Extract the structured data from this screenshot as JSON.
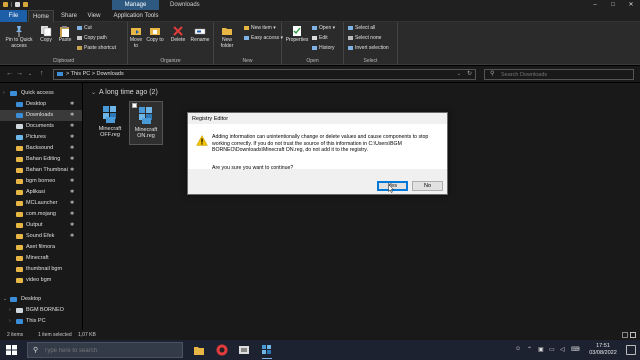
{
  "window": {
    "title": "Downloads",
    "context_tab": "Manage",
    "controls": [
      "–",
      "□",
      "✕"
    ]
  },
  "tabs": [
    "File",
    "Home",
    "Share",
    "View",
    "Application Tools"
  ],
  "ribbon": {
    "clipboard": {
      "pin": "Pin to Quick access",
      "copy": "Copy",
      "paste": "Paste",
      "cut": "Cut",
      "copy_path": "Copy path",
      "paste_shortcut": "Paste shortcut",
      "label": "Clipboard"
    },
    "organize": {
      "move_to": "Move to",
      "copy_to": "Copy to",
      "delete": "Delete",
      "rename": "Rename",
      "label": "Organize"
    },
    "new": {
      "new_folder": "New folder",
      "new_item": "New item",
      "easy_access": "Easy access",
      "label": "New"
    },
    "open": {
      "properties": "Properties",
      "open": "Open",
      "edit": "Edit",
      "history": "History",
      "label": "Open"
    },
    "select": {
      "select_all": "Select all",
      "select_none": "Select none",
      "invert": "Invert selection",
      "label": "Select"
    }
  },
  "address": {
    "path_1": "This PC",
    "path_2": "Downloads",
    "separator": ">",
    "search_placeholder": "Search Downloads"
  },
  "nav": {
    "quick_access": "Quick access",
    "items": [
      "Desktop",
      "Downloads",
      "Documents",
      "Pictures",
      "Backsound",
      "Bahan Editing",
      "Bahan Thumbnai",
      "bgm borneo",
      "Aplikasi",
      "MCLauncher",
      "com.mojang",
      "Output",
      "Sound Efek",
      "Aset filmora",
      "Minecraft",
      "thumbnail bgm",
      "video bgm"
    ],
    "bottom": [
      "Desktop",
      "BGM BORNEO",
      "This PC"
    ]
  },
  "content": {
    "group_header": "A long time ago (2)",
    "files": [
      {
        "name_1": "Minecraft",
        "name_2": "OFF.reg"
      },
      {
        "name_1": "Minecraft",
        "name_2": "ON.reg"
      }
    ]
  },
  "dialog": {
    "title": "Registry Editor",
    "message": "Adding information can unintentionally change or delete values and cause components to stop working correctly. If you do not trust the source of this information in C:\\Users\\BGM BORNEO\\Downloads\\Minecraft ON.reg, do not add it to the registry.",
    "question": "Are you sure you want to continue?",
    "yes": "Yes",
    "no": "No"
  },
  "status": {
    "count": "2 items",
    "selected": "1 item selected",
    "size": "1,07 KB"
  },
  "taskbar": {
    "search_placeholder": "Type here to search",
    "time": "17:51",
    "date": "03/08/2022"
  },
  "colors": {
    "accent": "#0078d7",
    "folder": "#e8b645",
    "warning": "#f2c200"
  }
}
